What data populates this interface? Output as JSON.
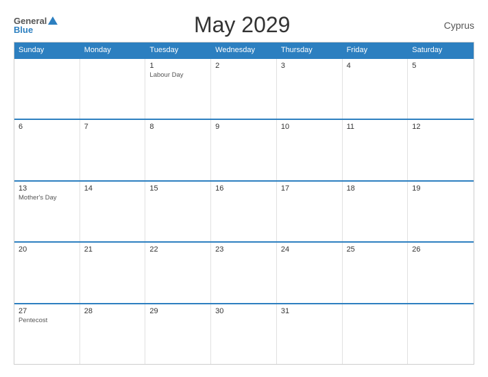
{
  "logo": {
    "general": "General",
    "blue": "Blue"
  },
  "header": {
    "title": "May 2029",
    "country": "Cyprus"
  },
  "calendar": {
    "days_of_week": [
      "Sunday",
      "Monday",
      "Tuesday",
      "Wednesday",
      "Thursday",
      "Friday",
      "Saturday"
    ],
    "weeks": [
      [
        {
          "day": "",
          "empty": true
        },
        {
          "day": "",
          "empty": true
        },
        {
          "day": "1",
          "event": "Labour Day"
        },
        {
          "day": "2"
        },
        {
          "day": "3"
        },
        {
          "day": "4"
        },
        {
          "day": "5"
        }
      ],
      [
        {
          "day": "6"
        },
        {
          "day": "7"
        },
        {
          "day": "8"
        },
        {
          "day": "9"
        },
        {
          "day": "10"
        },
        {
          "day": "11"
        },
        {
          "day": "12"
        }
      ],
      [
        {
          "day": "13",
          "event": "Mother's Day"
        },
        {
          "day": "14"
        },
        {
          "day": "15"
        },
        {
          "day": "16"
        },
        {
          "day": "17"
        },
        {
          "day": "18"
        },
        {
          "day": "19"
        }
      ],
      [
        {
          "day": "20"
        },
        {
          "day": "21"
        },
        {
          "day": "22"
        },
        {
          "day": "23"
        },
        {
          "day": "24"
        },
        {
          "day": "25"
        },
        {
          "day": "26"
        }
      ],
      [
        {
          "day": "27",
          "event": "Pentecost"
        },
        {
          "day": "28"
        },
        {
          "day": "29"
        },
        {
          "day": "30"
        },
        {
          "day": "31"
        },
        {
          "day": "",
          "empty": true
        },
        {
          "day": "",
          "empty": true
        }
      ]
    ]
  }
}
